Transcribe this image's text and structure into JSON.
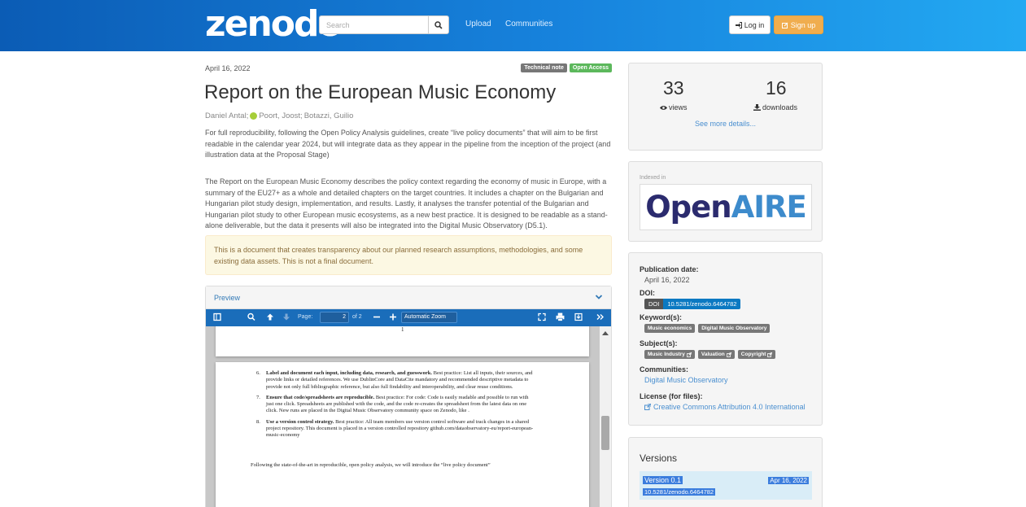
{
  "navbar": {
    "logo": "zenodo",
    "search_placeholder": "Search",
    "upload_label": "Upload",
    "communities_label": "Communities",
    "login_label": "Log in",
    "signup_label": "Sign up"
  },
  "record": {
    "date": "April 16, 2022",
    "badges": [
      "Technical note",
      "Open Access"
    ],
    "title": "Report on the European Music Economy",
    "authors": {
      "a1": "Daniel Antal;",
      "a2": "Poort, Joost;",
      "a3": "Botazzi, Guilio"
    },
    "para1": "For full reproducibility, following the Open Policy Analysis guidelines, create “live policy documents” that will aim to be first readable in the calendar year 2024, but will integrate data as they appear in the pipeline from the inception of the project (and illustration data at the Proposal Stage)",
    "para2": "The Report on the European Music Economy describes the policy context regarding the economy of music in Europe, with a summary of the EU27+ as a whole and detailed chapters on the target countries. It includes a chapter on the Bulgarian and Hungarian pilot study design, implementation, and results. Lastly, it analyses the transfer potential of the Bulgarian and Hungarian pilot study to other European music ecosystems, as a new best practice. It is designed to be readable as a stand-alone deliverable, but the data it presents will also be integrated into the Digital Music Observatory (D5.1).",
    "alert": "This is a document that creates transparency about our planned research assumptions, methodologies, and some existing data assets. This is not a final document."
  },
  "preview": {
    "label": "Preview",
    "page_label": "Page:",
    "page_value": "2",
    "page_of": "of 2",
    "zoom": "Automatic Zoom",
    "page1_number": "1",
    "items": [
      {
        "n": "6.",
        "bold": "Label and document each input, including data, research, and guesswork.",
        "text": " Best practice: List all inputs, their sources, and provide links or detailed references. We use DublinCore and DataCite mandatory and recommended descriptive metadata to provide not only full bibliographic reference, but also full findability and interoperability, and clear reuse conditions."
      },
      {
        "n": "7.",
        "bold": "Ensure that code/spreadsheets are reproducible.",
        "text": " Best practice: For code: Code is easily readable and possible to run with just one click. Spreadsheets are published with the code, and the code re-creates the spreadsheet from the latest data on one click. New runs are placed in the Digital Music Observatory community space on Zenodo, like ."
      },
      {
        "n": "8.",
        "bold": "Use a version control strategy.",
        "text": " Best practice: All team members use version control software and track changes in a shared project repository. This document is placed in a version controlled repository github.com/dataobservatory-eu/report-european-music-economy"
      }
    ],
    "foot": "Following the state-of-the-art in reproducible, open policy analysis, we will introduce the “live policy document”"
  },
  "stats": {
    "views": "33",
    "views_label": "views",
    "downloads": "16",
    "downloads_label": "downloads",
    "more": "See more details..."
  },
  "indexed": {
    "label": "Indexed in",
    "logo_open": "Open",
    "logo_aire": "AIRE"
  },
  "meta": {
    "pub_date_label": "Publication date:",
    "pub_date": "April 16, 2022",
    "doi_label": "DOI:",
    "doi_badge": "DOI",
    "doi": "10.5281/zenodo.6464782",
    "keywords_label": "Keyword(s):",
    "keywords": [
      "Music economics",
      "Digital Music Observatory"
    ],
    "subjects_label": "Subject(s):",
    "subjects": [
      "Music Industry",
      "Valuation",
      "Copyright"
    ],
    "communities_label": "Communities:",
    "community": "Digital Music Observatory",
    "license_label": "License (for files):",
    "license": "Creative Commons Attribution 4.0 International"
  },
  "versions": {
    "title": "Versions",
    "name": "Version 0.1",
    "date": "Apr 16, 2022",
    "doi": "10.5281/zenodo.6464782"
  },
  "colors": {
    "nav_start": "#0b5cb5",
    "nav_end": "#23a9f2",
    "signup": "#f0ad4e",
    "pdf_toolbar": "#1a6dba",
    "link": "#4a8fd0"
  }
}
